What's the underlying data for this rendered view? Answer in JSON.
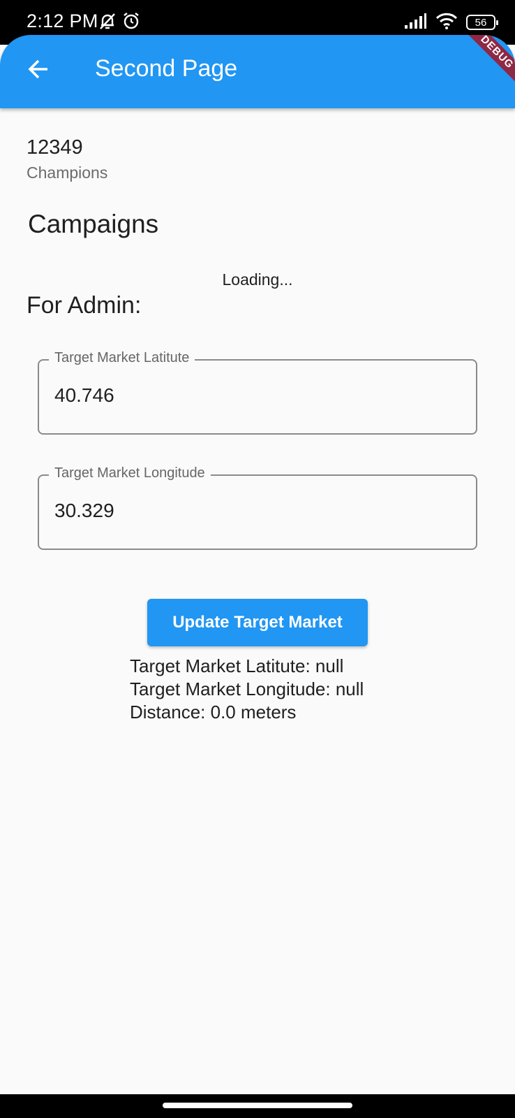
{
  "status_bar": {
    "time": "2:12 PM",
    "battery": "56",
    "icons_left": [
      "muted-bell-icon",
      "alarm-icon"
    ],
    "icons_right": [
      "signal-icon",
      "wifi-icon",
      "battery-icon"
    ]
  },
  "app_bar": {
    "title": "Second Page",
    "back_icon": "arrow-left-icon",
    "color": "#2196f3",
    "debug_banner": "DEBUG"
  },
  "summary": {
    "count": "12349",
    "label": "Champions"
  },
  "campaigns": {
    "title": "Campaigns",
    "status": "Loading..."
  },
  "admin": {
    "title": "For Admin:",
    "latitude_field": {
      "label": "Target Market Latitute",
      "value": "40.746"
    },
    "longitude_field": {
      "label": "Target Market Longitude",
      "value": "30.329"
    },
    "update_button": "Update Target Market",
    "results": {
      "latitude": "Target Market Latitute: null",
      "longitude": "Target Market Longitude: null",
      "distance": "Distance: 0.0 meters"
    }
  }
}
